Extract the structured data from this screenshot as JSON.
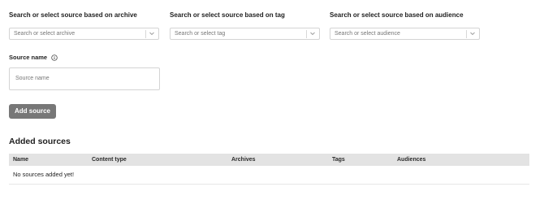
{
  "filters": {
    "archive": {
      "label": "Search or select source based on archive",
      "placeholder": "Search or select archive"
    },
    "tag": {
      "label": "Search or select source based on tag",
      "placeholder": "Search or select tag"
    },
    "audience": {
      "label": "Search or select source based on audience",
      "placeholder": "Search or select audience"
    }
  },
  "source_name": {
    "label": "Source name",
    "placeholder": "Source name"
  },
  "add_source_label": "Add source",
  "added_sources": {
    "heading": "Added sources",
    "columns": [
      "Name",
      "Content type",
      "Archives",
      "Tags",
      "Audiences"
    ],
    "empty_message": "No sources added yet!"
  },
  "colors": {
    "button_bg": "#777777",
    "table_header_bg": "#e3e3e3",
    "border": "#d4d4d4"
  },
  "icons": {
    "dropdown": "chevron-down-icon",
    "info": "info-icon"
  }
}
